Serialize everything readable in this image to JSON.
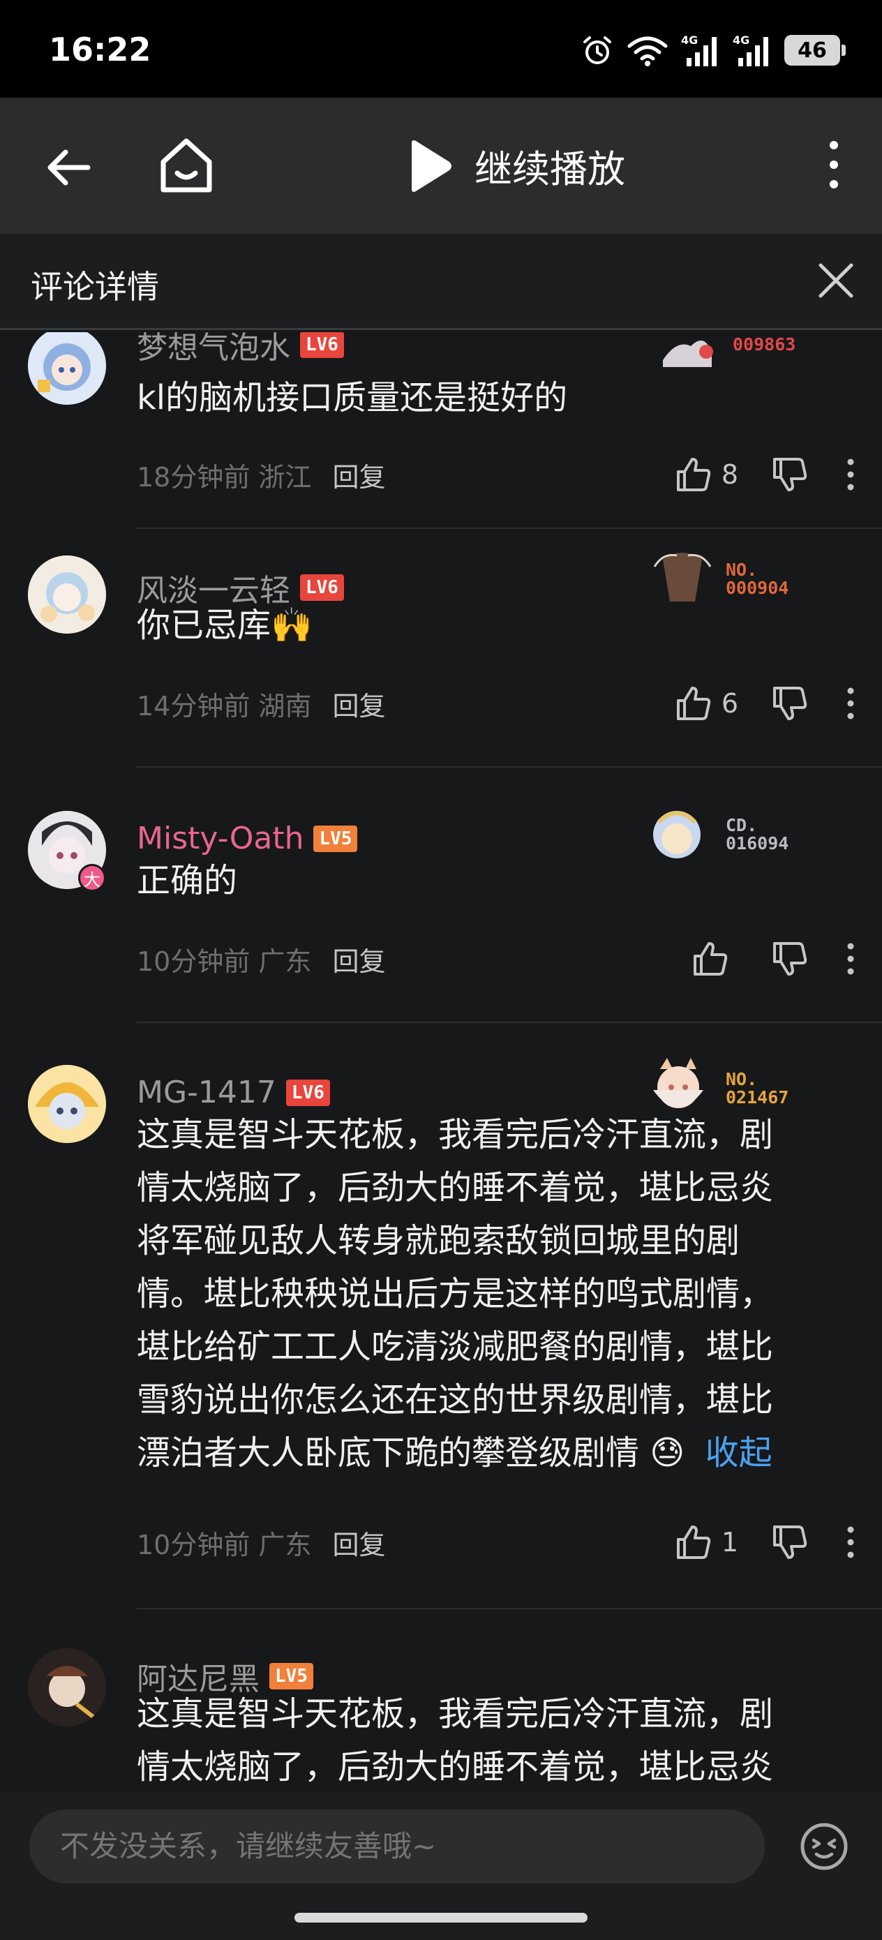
{
  "status_bar": {
    "time": "16:22",
    "battery": "46"
  },
  "top_nav": {
    "play_label": "继续播放"
  },
  "header": {
    "title": "评论详情"
  },
  "comments": [
    {
      "username": "梦想气泡水",
      "level": "LV6",
      "deco_no": [
        "",
        "009863"
      ],
      "deco_color": "#e2484a",
      "text": "kl的脑机接口质量还是挺好的",
      "time": "18分钟前 浙江",
      "reply": "回复",
      "likes": "8"
    },
    {
      "username": "风淡一云轻",
      "level": "LV6",
      "deco_no": [
        "NO.",
        "000904"
      ],
      "deco_color": "#e0683a",
      "text": "你已忌库🙌",
      "time": "14分钟前 湖南",
      "reply": "回复",
      "likes": "6"
    },
    {
      "username": "Misty-Oath",
      "level": "LV5",
      "avatar_badge": "大",
      "deco_no": [
        "CD.",
        "016094"
      ],
      "deco_color": "#b9bcc4",
      "text": "正确的",
      "time": "10分钟前 广东",
      "reply": "回复",
      "likes": ""
    },
    {
      "username": "MG-1417",
      "level": "LV6",
      "deco_no": [
        "NO.",
        "021467"
      ],
      "deco_color": "#e8a53a",
      "text_lines": [
        "这真是智斗天花板，我看完后冷汗直流，剧",
        "情太烧脑了，后劲大的睡不着觉，堪比忌炎",
        "将军碰见敌人转身就跑索敌锁回城里的剧",
        "情。堪比秧秧说出后方是这样的鸣式剧情，",
        "堪比给矿工工人吃清淡减肥餐的剧情，堪比",
        "雪豹说出你怎么还在这的世界级剧情，堪比",
        "漂泊者大人卧底下跪的攀登级剧情"
      ],
      "emoji": "😓",
      "collapse": "收起",
      "time": "10分钟前 广东",
      "reply": "回复",
      "likes": "1"
    },
    {
      "username": "阿达尼黑",
      "level": "LV5",
      "text_lines": [
        "这真是智斗天花板，我看完后冷汗直流，剧",
        "情太烧脑了，后劲大的睡不着觉，堪比忌炎"
      ]
    }
  ],
  "input": {
    "placeholder": "不发没关系，请继续友善哦~"
  },
  "colors": {
    "bg": "#17181a",
    "nav": "#2b2c2e",
    "lv6": "#e8453c",
    "lv5": "#f0803a",
    "link": "#4aa3f0",
    "pink_name": "#e8678e"
  }
}
